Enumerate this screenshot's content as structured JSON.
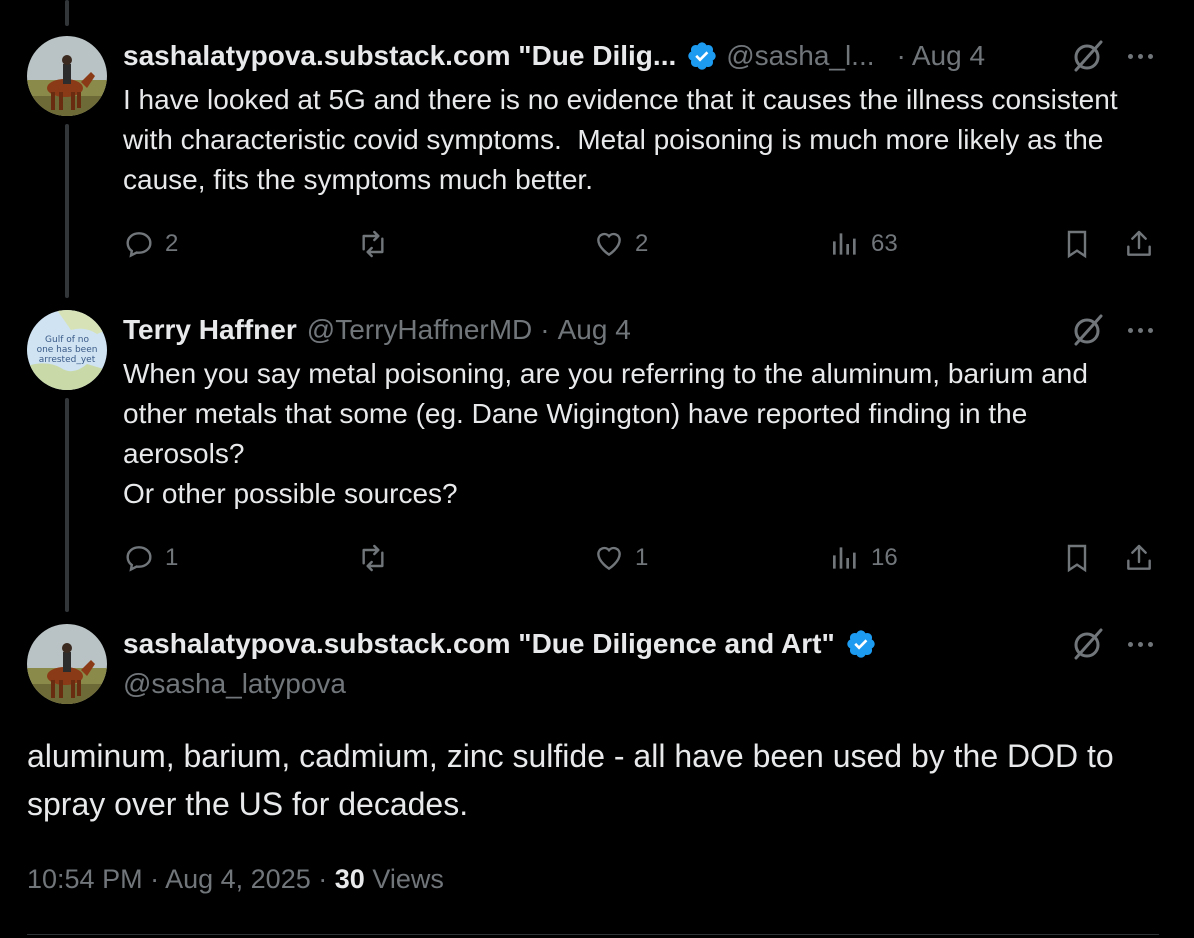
{
  "tweets": [
    {
      "name": "sashalatypova.substack.com \"Due Dilig...",
      "handle": "@sasha_l...",
      "separator": "·",
      "date": "Aug 4",
      "text": "I have looked at 5G and there is no evidence that it causes the illness consistent with characteristic covid symptoms.  Metal poisoning is much more likely as the cause, fits the symptoms much better.",
      "replies": "2",
      "likes": "2",
      "views": "63"
    },
    {
      "name": "Terry Haffner",
      "handle": "@TerryHaffnerMD",
      "separator": "·",
      "date": "Aug 4",
      "avatar_text": "Gulf of no one has been arrested_yet",
      "text": "When you say metal poisoning, are you referring to the aluminum, barium and other metals that some (eg. Dane Wigington) have reported finding in the aerosols?\nOr other possible sources?",
      "replies": "1",
      "likes": "1",
      "views": "16"
    }
  ],
  "main_tweet": {
    "name": "sashalatypova.substack.com \"Due Diligence and Art\"",
    "handle": "@sasha_latypova",
    "text": "aluminum, barium, cadmium, zinc sulfide - all have been used by the DOD to spray over the US for decades.",
    "time": "10:54 PM",
    "date": "Aug 4, 2025",
    "separator": "·",
    "views_count": "30",
    "views_label": "Views"
  },
  "icons": {
    "verified": "verified-badge-icon",
    "grok": "grok-icon",
    "more": "more-icon",
    "reply": "reply-icon",
    "retweet": "retweet-icon",
    "like": "like-icon",
    "views": "views-icon",
    "bookmark": "bookmark-icon",
    "share": "share-icon"
  },
  "colors": {
    "background": "#000000",
    "text": "#e7e9ea",
    "secondary": "#71767b",
    "verified": "#1d9bf0"
  }
}
